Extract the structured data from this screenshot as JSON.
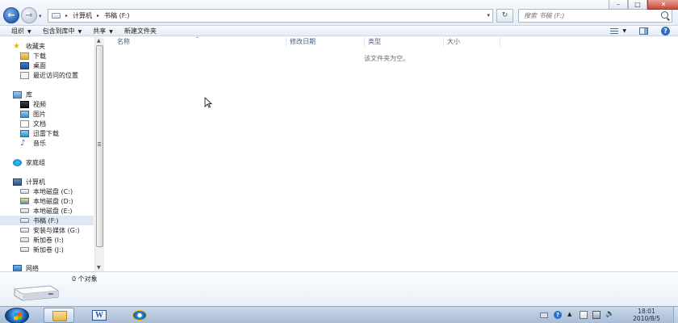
{
  "window": {
    "controls": {
      "minimize": "–",
      "maximize": "□",
      "close": "✕"
    }
  },
  "address": {
    "crumbs": [
      "计算机",
      "书稿 (F:)"
    ],
    "search_placeholder": "搜索 书稿 (F:)"
  },
  "toolbar": {
    "items": [
      "组织",
      "包含到库中",
      "共享",
      "新建文件夹"
    ]
  },
  "nav": {
    "favorites": {
      "label": "收藏夹",
      "items": [
        "下载",
        "桌面",
        "最近访问的位置"
      ]
    },
    "libraries": {
      "label": "库",
      "items": [
        "视频",
        "图片",
        "文档",
        "迅雷下载",
        "音乐"
      ]
    },
    "homegroup": "家庭组",
    "computer": {
      "label": "计算机",
      "items": [
        "本地磁盘 (C:)",
        "本地磁盘 (D:)",
        "本地磁盘 (E:)",
        "书稿 (F:)",
        "安装与媒体 (G:)",
        "新加卷 (I:)",
        "新加卷 (J:)"
      ]
    },
    "network": "网络"
  },
  "content": {
    "columns": [
      "名称",
      "修改日期",
      "类型",
      "大小"
    ],
    "empty_message": "该文件夹为空。"
  },
  "details": {
    "count": "0 个对象"
  },
  "taskbar": {
    "time": "18:01",
    "date": "2010/8/5"
  }
}
